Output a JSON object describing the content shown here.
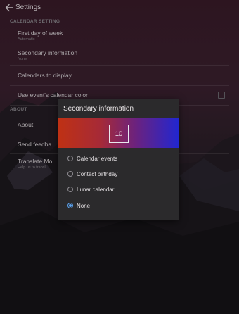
{
  "header": {
    "title": "Settings"
  },
  "calendar_setting": {
    "header": "CALENDAR SETTING",
    "items": [
      {
        "title": "First day of week",
        "subtitle": "Automatic"
      },
      {
        "title": "Secondary information",
        "subtitle": "None"
      },
      {
        "title": "Calendars to display"
      },
      {
        "title": "Use event's calendar color",
        "checked": false
      }
    ]
  },
  "about": {
    "header": "ABOUT",
    "items": [
      {
        "title": "About"
      },
      {
        "title": "Send feedba"
      },
      {
        "title": "Translate Mo",
        "subtitle": "Help us to transl"
      }
    ]
  },
  "dialog": {
    "title": "Secondary information",
    "preview_day": "10",
    "options": [
      {
        "label": "Calendar events",
        "selected": false
      },
      {
        "label": "Contact birthday",
        "selected": false
      },
      {
        "label": "Lunar calendar",
        "selected": false
      },
      {
        "label": "None",
        "selected": true
      }
    ]
  },
  "colors": {
    "accent": "#5aa2ee",
    "dialog_bg": "#2b2a2c",
    "preview_start": "#bf3114",
    "preview_end": "#2226d0"
  },
  "icons": {
    "back": "back-arrow-icon"
  }
}
